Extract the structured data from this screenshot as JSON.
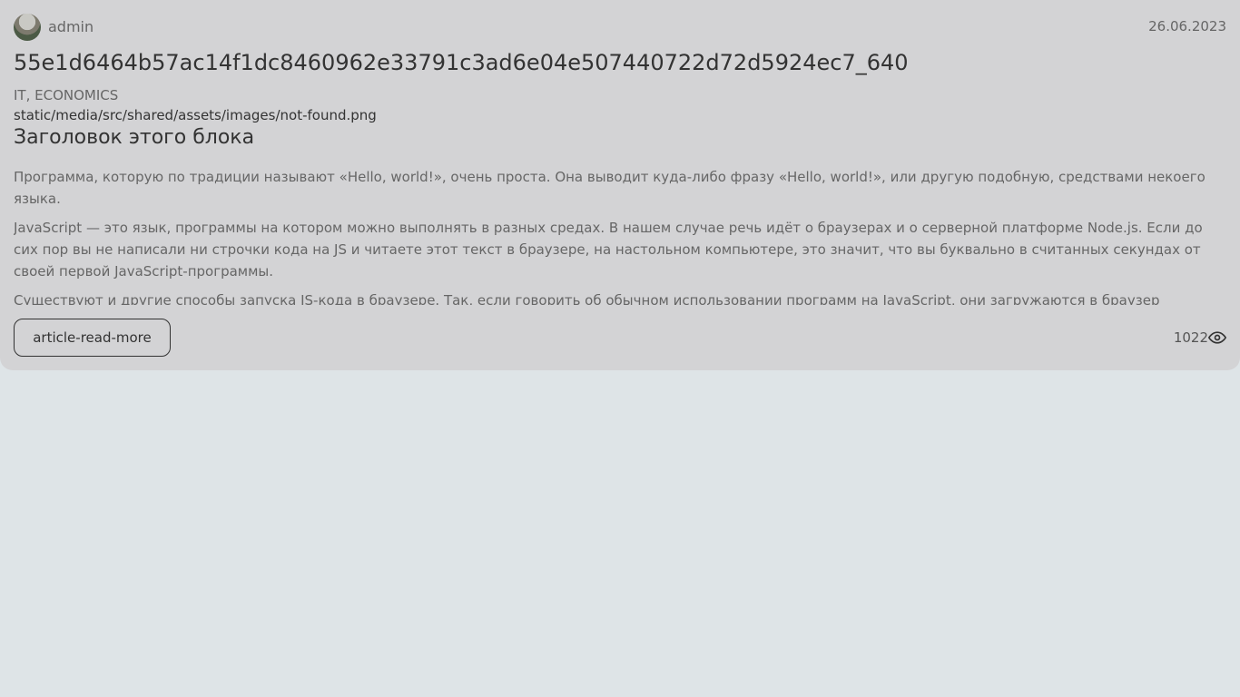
{
  "article": {
    "username": "admin",
    "date": "26.06.2023",
    "title": "55e1d6464b57ac14f1dc8460962e33791c3ad6e04e507440722d72d5924ec7_640",
    "types": "IT, ECONOMICS",
    "image_path": "static/media/src/shared/assets/images/not-found.png",
    "block_title": "Заголовок этого блока",
    "paragraphs": [
      "Программа, которую по традиции называют «Hello, world!», очень проста. Она выводит куда-либо фразу «Hello, world!», или другую подобную, средствами некоего языка.",
      "JavaScript — это язык, программы на котором можно выполнять в разных средах. В нашем случае речь идёт о браузерах и о серверной платформе Node.js. Если до сих пор вы не написали ни строчки кода на JS и читаете этот текст в браузере, на настольном компьютере, это значит, что вы буквально в считанных секундах от своей первой JavaScript-программы.",
      "Существуют и другие способы запуска JS-кода в браузере. Так, если говорить об обычном использовании программ на JavaScript, они загружаются в браузер"
    ],
    "read_more_label": "article-read-more",
    "views": "1022",
    "views_icon": "eye-icon"
  }
}
